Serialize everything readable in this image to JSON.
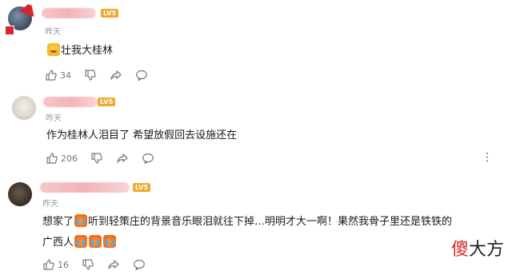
{
  "comments": [
    {
      "level": "LV5",
      "time": "昨天",
      "text": "壮我大桂林",
      "likes": "34",
      "avatar_icon": "christmas-hat-avatar",
      "show_more": false
    },
    {
      "level": "LV5",
      "time": "昨天",
      "text": "作为桂林人泪目了 希望放假回去设施还在",
      "likes": "206",
      "avatar_icon": "dog-avatar",
      "show_more": true,
      "more_label": "⋮"
    },
    {
      "level": "LV5",
      "time": "昨天",
      "text_part1": "想家了",
      "text_part2": "听到轻策庄的背景音乐眼泪就往下掉…明明才大一啊！果然我骨子里还是铁铁的",
      "text_line2": "广西人",
      "likes": "16",
      "avatar_icon": "dark-portrait-avatar",
      "show_more": false
    }
  ],
  "watermark": {
    "red_part": "傻",
    "rest": "大方"
  },
  "colors": {
    "level_badge": "#f0a830",
    "time": "#999999",
    "icon": "#777777",
    "name_blur": "#f3b3b8"
  }
}
